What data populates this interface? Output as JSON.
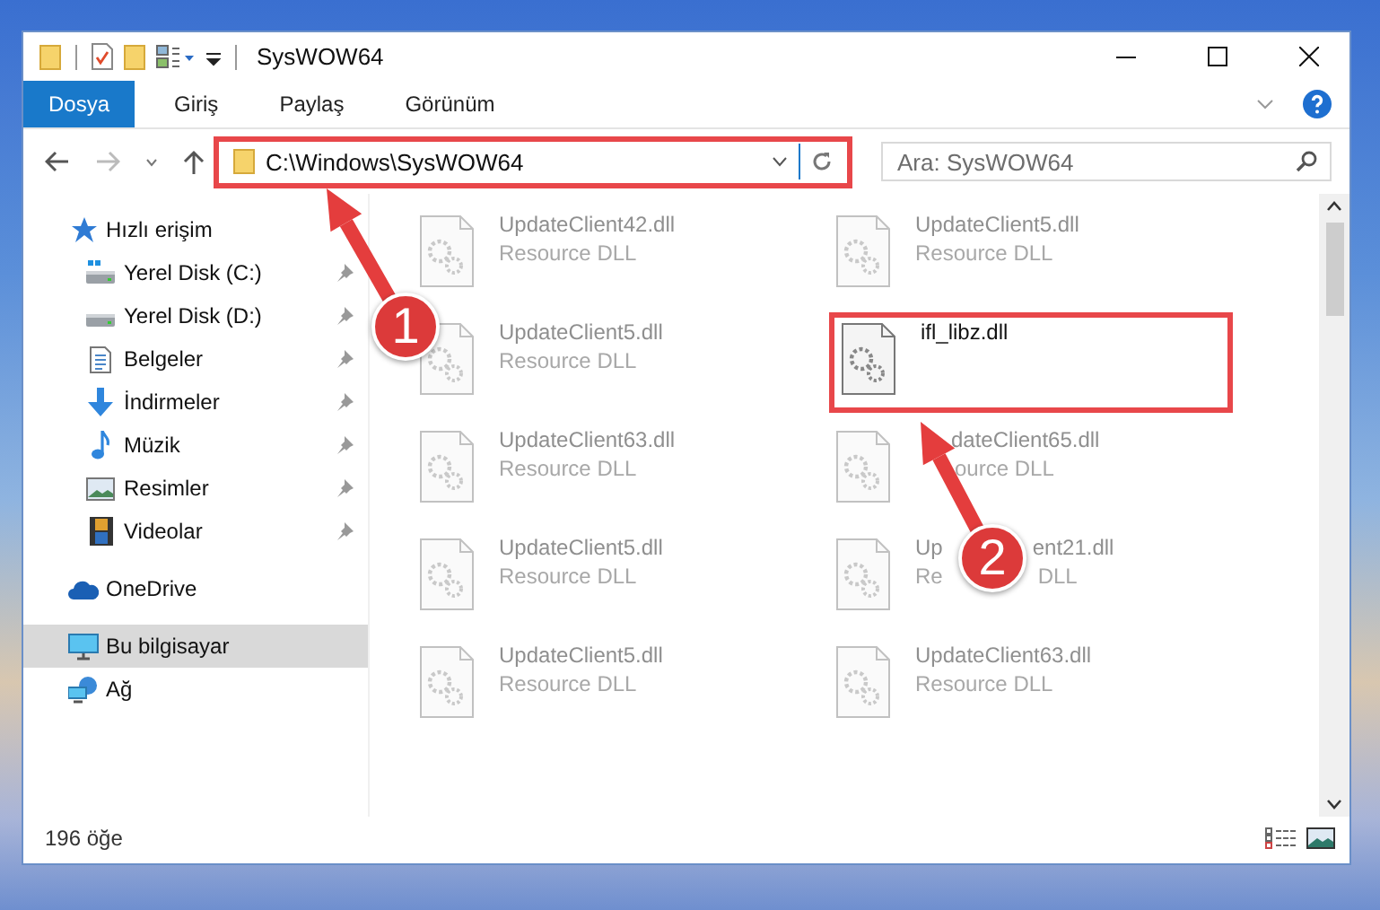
{
  "window": {
    "title": "SysWOW64"
  },
  "ribbon_tabs": [
    {
      "label": "Dosya",
      "selected": true
    },
    {
      "label": "Giriş",
      "selected": false
    },
    {
      "label": "Paylaş",
      "selected": false
    },
    {
      "label": "Görünüm",
      "selected": false
    }
  ],
  "address_bar": {
    "value": "C:\\Windows\\SysWOW64",
    "highlighted": true
  },
  "search": {
    "placeholder": "Ara: SysWOW64"
  },
  "sidebar": {
    "items": [
      {
        "label": "Hızlı erişim",
        "kind": "star",
        "selected": false,
        "children": [
          {
            "label": "Yerel Disk (C:)",
            "kind": "drive-c",
            "pinned": true
          },
          {
            "label": "Yerel Disk (D:)",
            "kind": "drive",
            "pinned": true
          },
          {
            "label": "Belgeler",
            "kind": "document",
            "pinned": true
          },
          {
            "label": "İndirmeler",
            "kind": "download",
            "pinned": true
          },
          {
            "label": "Müzik",
            "kind": "music",
            "pinned": true
          },
          {
            "label": "Resimler",
            "kind": "picture",
            "pinned": true
          },
          {
            "label": "Videolar",
            "kind": "video",
            "pinned": true
          }
        ]
      },
      {
        "label": "OneDrive",
        "kind": "cloud",
        "selected": false
      },
      {
        "label": "Bu bilgisayar",
        "kind": "computer",
        "selected": true
      },
      {
        "label": "Ağ",
        "kind": "network",
        "selected": false
      }
    ]
  },
  "files": [
    {
      "name_parts": [
        "UpdateClient42.dll"
      ],
      "type_parts": [
        "Resource DLL"
      ],
      "highlighted": false
    },
    {
      "name_parts": [
        "UpdateClient5.dll"
      ],
      "type_parts": [
        "Resource DLL"
      ],
      "highlighted": false
    },
    {
      "name_parts": [
        "UpdateClient5.dll"
      ],
      "type_parts": [
        "Resource DLL"
      ],
      "highlighted": false
    },
    {
      "name_parts": [
        "ifl_libz.dll"
      ],
      "highlighted": true
    },
    {
      "name_parts": [
        "UpdateClient63.dll"
      ],
      "type_parts": [
        "Resource DLL"
      ],
      "highlighted": false
    },
    {
      "name_parts": [
        "dateClient65.dll"
      ],
      "type_parts": [
        "ource DLL"
      ],
      "highlighted": false
    },
    {
      "name_parts": [
        "UpdateClient5.dll"
      ],
      "type_parts": [
        "Resource DLL"
      ],
      "highlighted": false
    },
    {
      "name_parts": [
        "Up",
        "ent21.dll"
      ],
      "type_parts": [
        "Re",
        "DLL"
      ],
      "highlighted": false
    },
    {
      "name_parts": [
        "UpdateClient5.dll"
      ],
      "type_parts": [
        "Resource DLL"
      ],
      "highlighted": false
    },
    {
      "name_parts": [
        "UpdateClient63.dll"
      ],
      "type_parts": [
        "Resource DLL"
      ],
      "highlighted": false
    }
  ],
  "status_bar": {
    "item_count": "196 öğe"
  },
  "callouts": [
    {
      "number": "1"
    },
    {
      "number": "2"
    }
  ]
}
